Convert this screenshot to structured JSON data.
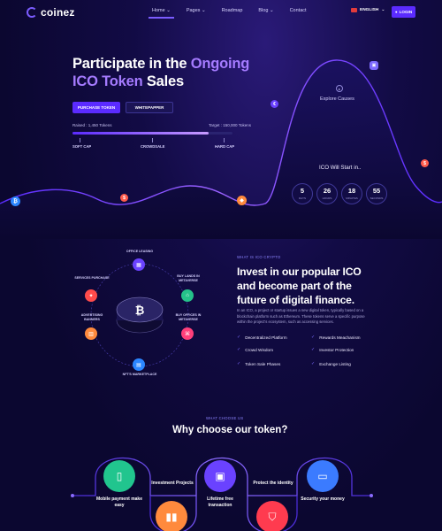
{
  "nav": {
    "logo": "coinez",
    "items": [
      {
        "label": "Home",
        "has_dropdown": true,
        "active": true
      },
      {
        "label": "Pages",
        "has_dropdown": true,
        "active": false
      },
      {
        "label": "Roadmap",
        "has_dropdown": false,
        "active": false
      },
      {
        "label": "Blog",
        "has_dropdown": true,
        "active": false
      },
      {
        "label": "Contact",
        "has_dropdown": false,
        "active": false
      }
    ],
    "language": "ENGLISH",
    "login": "LOGIN"
  },
  "hero": {
    "title_line1_a": "Participate in the ",
    "title_line1_b": "Ongoing",
    "title_line2_a": "ICO Token",
    "title_line2_b": " Sales",
    "btn_purchase": "PURCHASE TOKEN",
    "btn_whitepaper": "WHITEPAPPER",
    "raised": "Raised : 1,450 Tokens",
    "target": "Target : 150,000 Tokens",
    "progress_fraction": 0.85,
    "milestones": [
      "SOFT CAP",
      "CROWDSALE",
      "HARD CAP"
    ],
    "explore": "Explore Causes",
    "ico_start": "ICO Will Start in..",
    "countdown": [
      {
        "value": "5",
        "label": "DAYS"
      },
      {
        "value": "26",
        "label": "HOURS"
      },
      {
        "value": "18",
        "label": "MINUTES"
      },
      {
        "value": "55",
        "label": "SECONDS"
      }
    ]
  },
  "about": {
    "eyebrow": "WHAT IS ICO CRYPTO",
    "title": "Invest in our popular ICO and become part of the future of digital finance.",
    "description": "In an ICO, a project or startup issues a new digital token, typically based on a blockchain platform such as Ethereum. These tokens serve a specific purpose within the project's ecosystem, such as accessing services.",
    "features": [
      "Decentralized Platform",
      "Rewards Meachanism",
      "Crowd Wisdom",
      "Investor Protection",
      "Token Sale Phases",
      "Exchange Listing"
    ],
    "orbit": [
      {
        "label": "OFFICE LEASING",
        "color": "#6a42ff"
      },
      {
        "label": "BUY LANDS IN METAVERSE",
        "color": "#25c28a"
      },
      {
        "label": "BUY OFFICES IN METAVERSE",
        "color": "#ff3f7a"
      },
      {
        "label": "NFT'S MARKETPLACE",
        "color": "#2b86ff"
      },
      {
        "label": "ADVERTISING BANNERS",
        "color": "#ff8a3d"
      },
      {
        "label": "SERVICES PURCHASE",
        "color": "#ff4b4b"
      }
    ],
    "coin_symbol": "₿"
  },
  "why": {
    "eyebrow": "WHAT CHOOSE US",
    "title": "Why choose our token?",
    "items": [
      {
        "label": "Mobile payment make easy",
        "color": "#21c58e",
        "icon": "phone-icon"
      },
      {
        "label": "Investment Projects",
        "color": "#ff8a3d",
        "icon": "chart-icon"
      },
      {
        "label": "Lifetime free transaction",
        "color": "#6a42ff",
        "icon": "wallet-icon"
      },
      {
        "label": "Protect the identity",
        "color": "#ff3b4f",
        "icon": "shield-icon"
      },
      {
        "label": "Security your money",
        "color": "#3b7bff",
        "icon": "card-icon"
      }
    ]
  }
}
